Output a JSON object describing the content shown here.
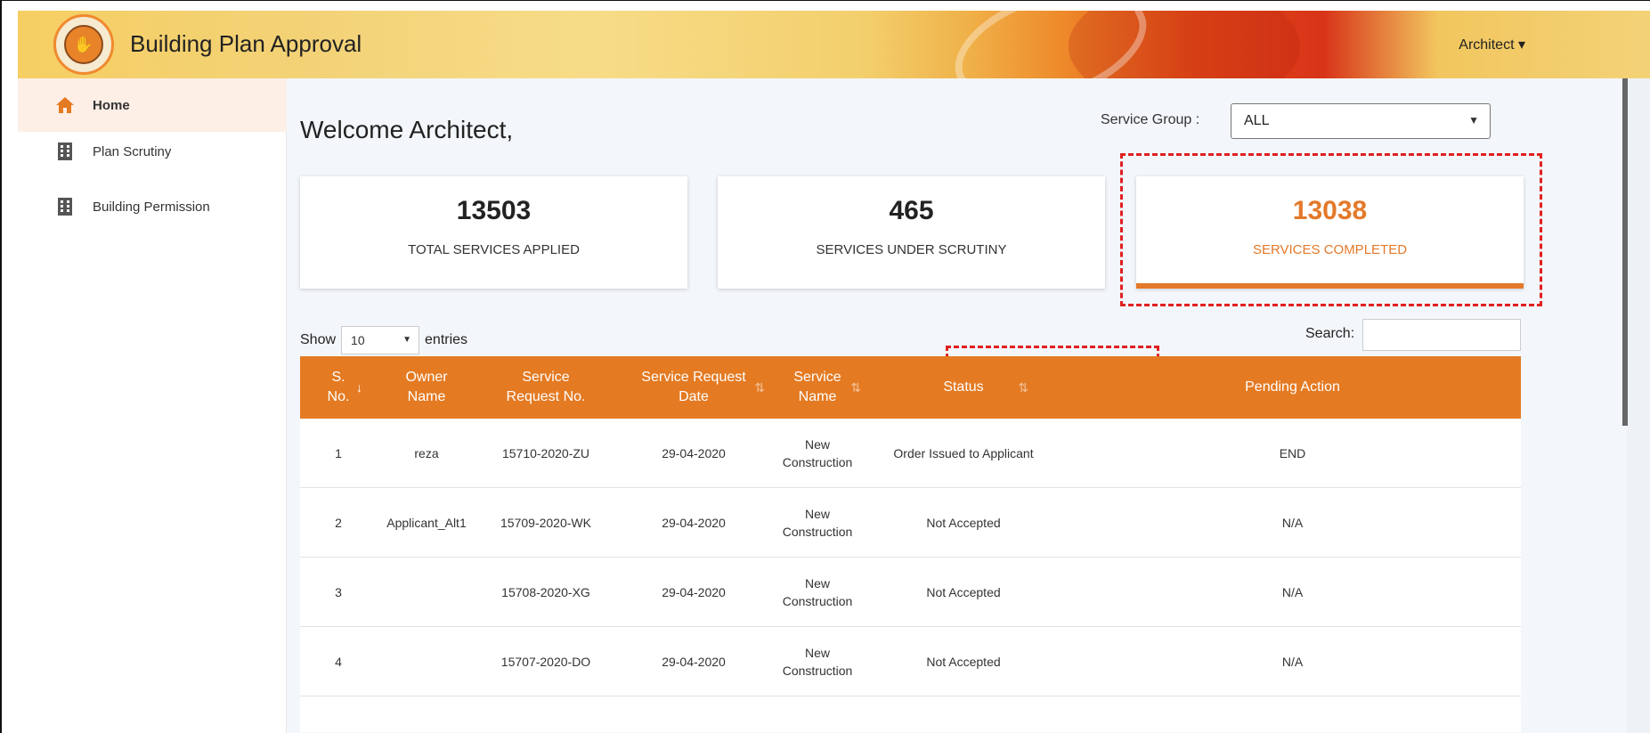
{
  "header": {
    "title": "Building Plan Approval",
    "user_menu": "Architect ▾"
  },
  "sidebar": {
    "items": [
      {
        "label": "Home",
        "icon": "home-icon",
        "active": true
      },
      {
        "label": "Plan Scrutiny",
        "icon": "building-icon"
      },
      {
        "label": "Building Permission",
        "icon": "building-icon"
      }
    ]
  },
  "main": {
    "welcome": "Welcome Architect,",
    "service_group_label": "Service Group :",
    "service_group_value": "ALL",
    "cards": [
      {
        "value": "13503",
        "caption": "TOTAL SERVICES APPLIED"
      },
      {
        "value": "465",
        "caption": "SERVICES UNDER SCRUTINY"
      },
      {
        "value": "13038",
        "caption": "SERVICES COMPLETED"
      }
    ],
    "show_label": "Show",
    "entries_value": "10",
    "entries_label": "entries",
    "search_label": "Search:"
  },
  "table": {
    "headers": [
      "S. No.",
      "Owner Name",
      "Service Request No.",
      "Service Request Date",
      "Service Name",
      "Status",
      "Pending Action"
    ],
    "rows": [
      [
        "1",
        "reza",
        "15710-2020-ZU",
        "29-04-2020",
        "New Construction",
        "Order Issued to Applicant",
        "END"
      ],
      [
        "2",
        "Applicant_Alt1",
        "15709-2020-WK",
        "29-04-2020",
        "New Construction",
        "Not Accepted",
        "N/A"
      ],
      [
        "3",
        "",
        "15708-2020-XG",
        "29-04-2020",
        "New Construction",
        "Not Accepted",
        "N/A"
      ],
      [
        "4",
        "",
        "15707-2020-DO",
        "29-04-2020",
        "New Construction",
        "Not Accepted",
        "N/A"
      ]
    ]
  },
  "colors": {
    "accent": "#e47a22",
    "annotation": "#e02020"
  }
}
